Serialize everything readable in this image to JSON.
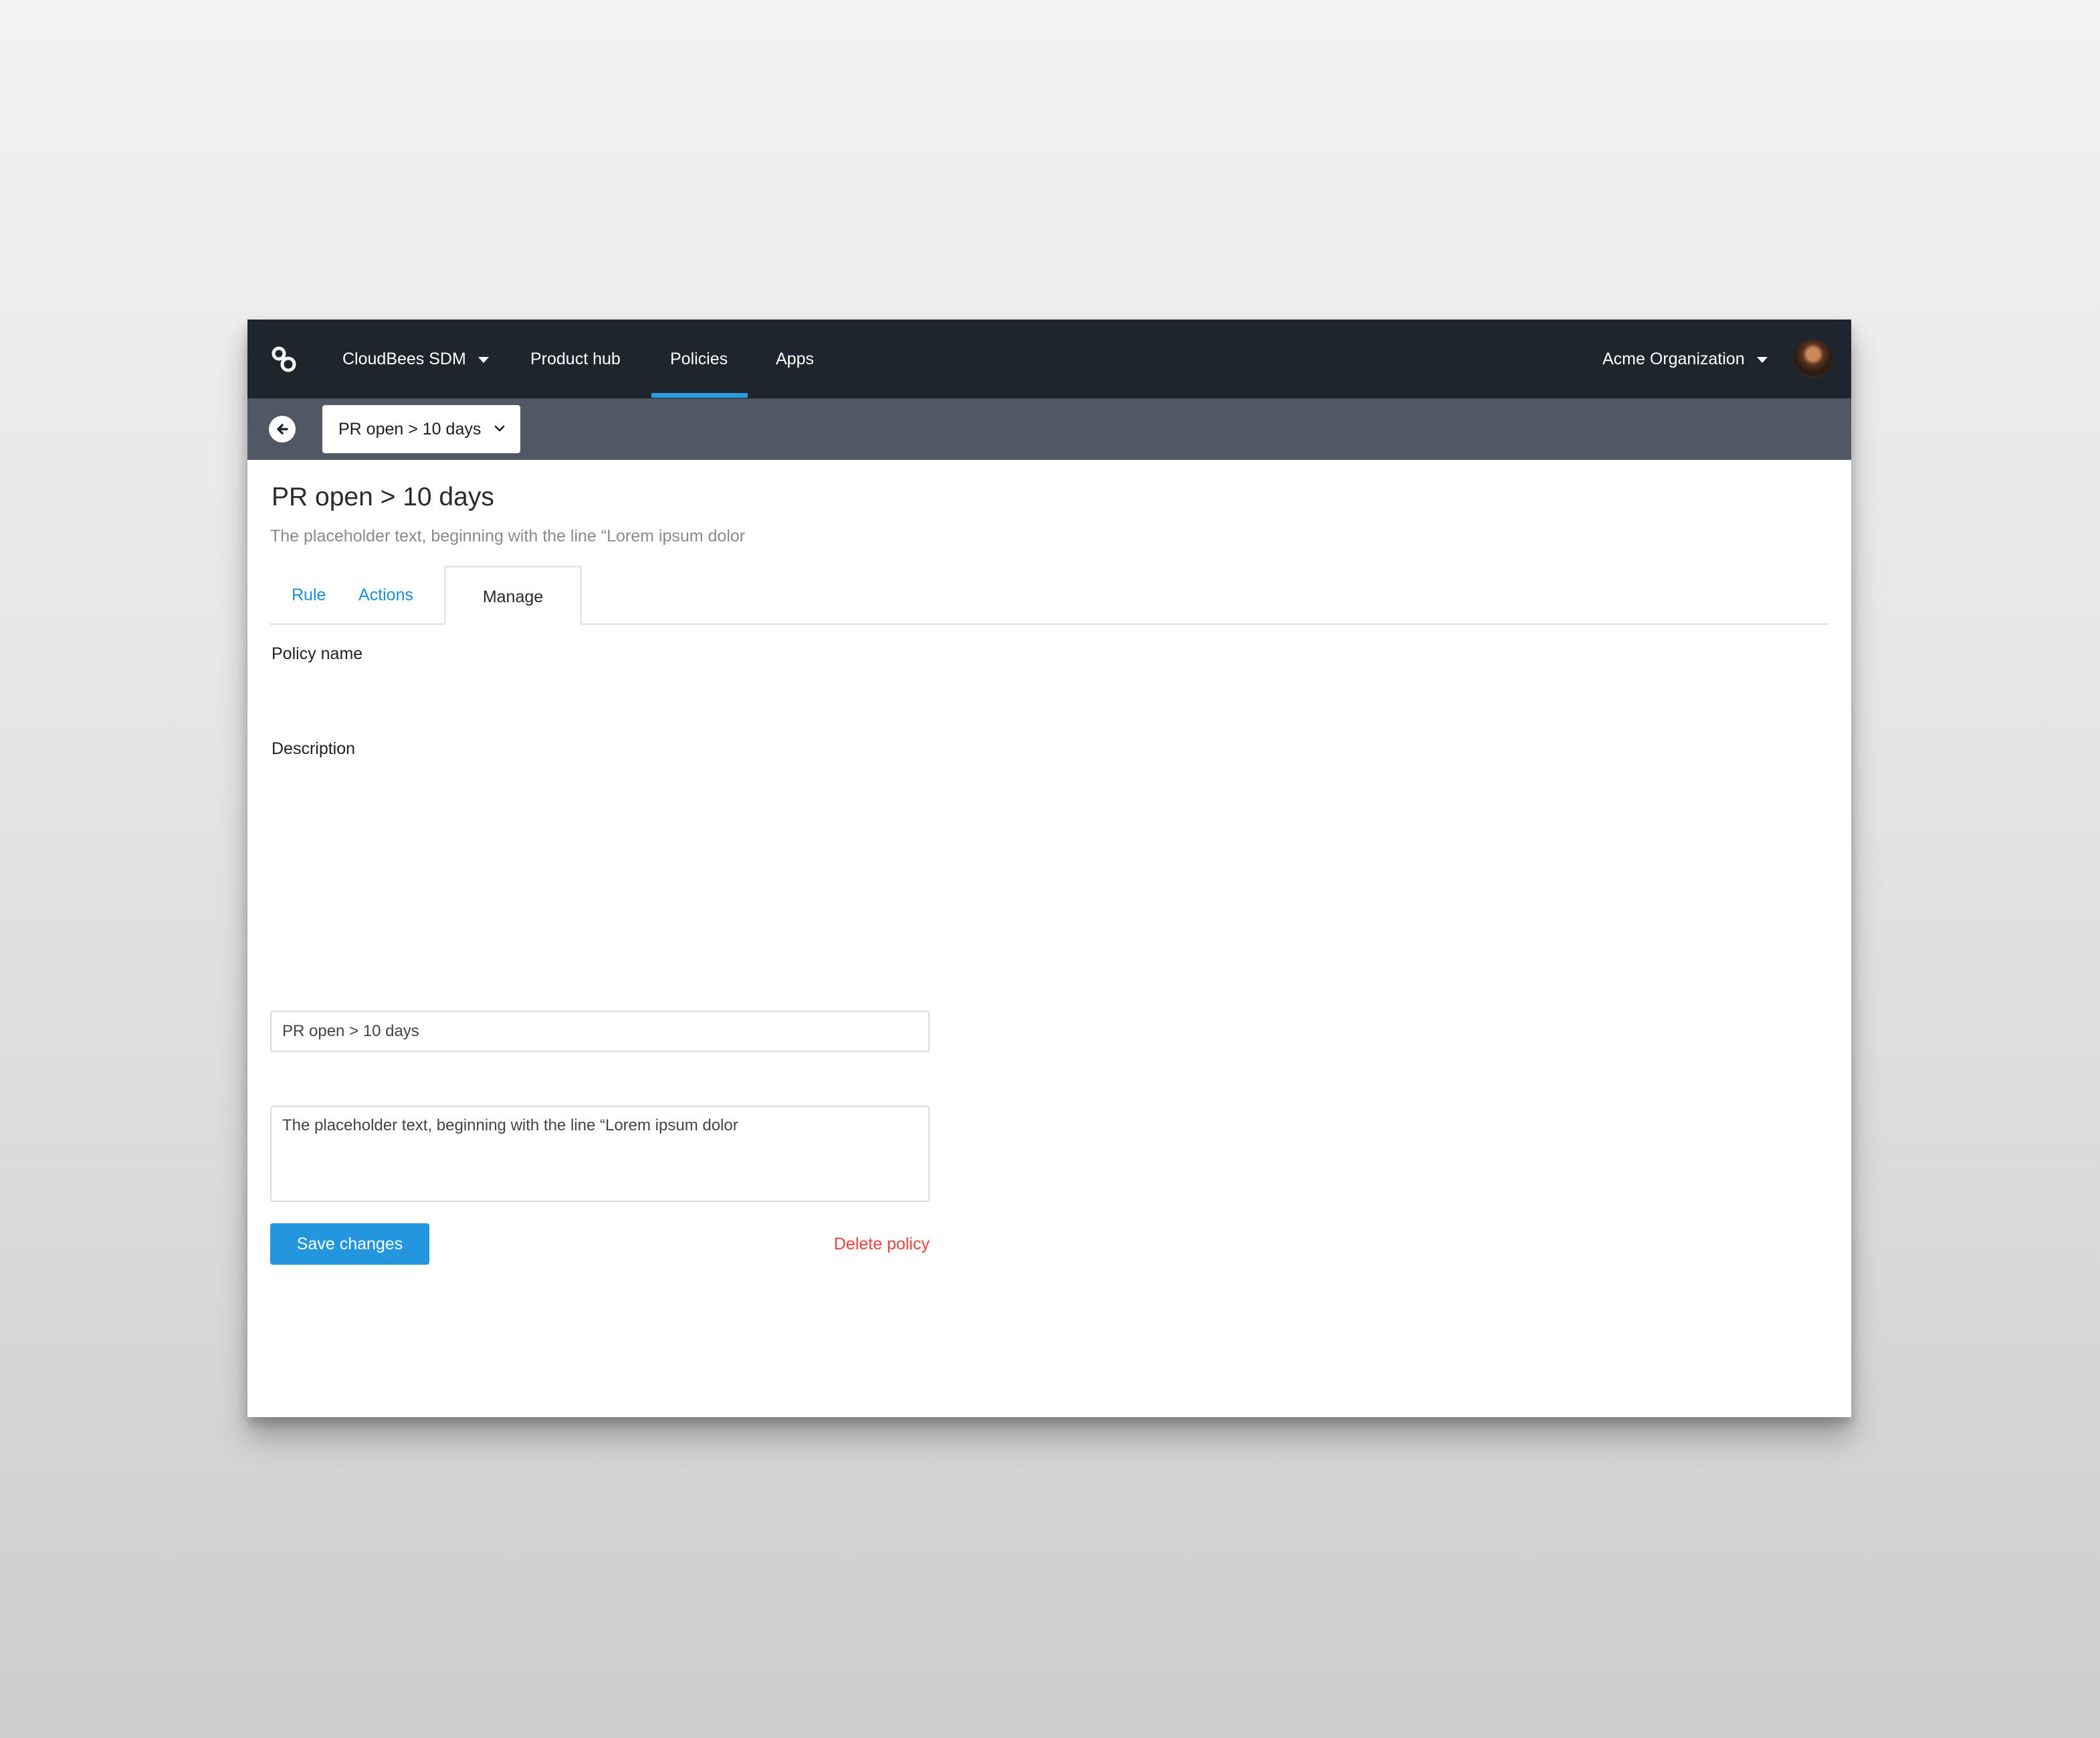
{
  "topnav": {
    "logo_icon": "cloudbees-logo-icon",
    "product_switcher": "CloudBees SDM",
    "items": [
      {
        "label": "Product hub"
      },
      {
        "label": "Policies",
        "active": true
      },
      {
        "label": "Apps"
      }
    ],
    "organization": "Acme Organization",
    "avatar_icon": "user-avatar",
    "active_indicator_color": "#2d9be3"
  },
  "subbar": {
    "back_icon": "arrow-left-icon",
    "policy_select_value": "PR open > 10 days",
    "select_icon": "chevron-down-icon"
  },
  "page": {
    "title": "PR open > 10 days",
    "subtitle": "The placeholder text, beginning with the line “Lorem ipsum dolor"
  },
  "tabs": [
    {
      "label": "Rule",
      "active": false
    },
    {
      "label": "Actions",
      "active": false
    },
    {
      "label": "Manage",
      "active": true
    }
  ],
  "form": {
    "policy_name_label": "Policy name",
    "policy_name_value": "PR open > 10 days",
    "description_label": "Description",
    "description_value": "The placeholder text, beginning with the line “Lorem ipsum dolor",
    "save_label": "Save changes",
    "delete_label": "Delete policy"
  },
  "colors": {
    "nav_bg": "#1f252d",
    "subbar_bg": "#4f5863",
    "link": "#1d8ed9",
    "primary": "#2496e0",
    "danger": "#f1413e"
  }
}
